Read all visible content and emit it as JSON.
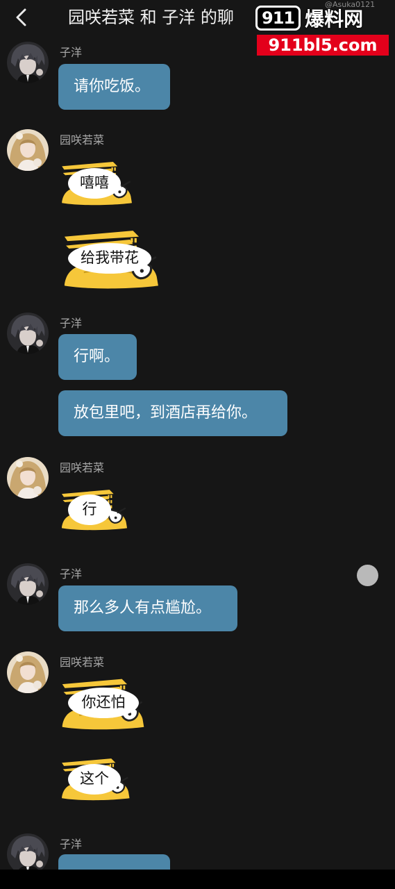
{
  "header": {
    "title": "园咲若菜 和 子洋 的聊",
    "credit": "@Asuka0121"
  },
  "watermark": {
    "logo_text": "911",
    "site_name": "爆料网",
    "url": "911bl5.com"
  },
  "participants": {
    "ziyang": "子洋",
    "wakana": "园咲若菜"
  },
  "messages": [
    {
      "sender": "子洋",
      "type": "text",
      "text": "请你吃饭。"
    },
    {
      "sender": "园咲若菜",
      "type": "sticker",
      "text": "嘻嘻"
    },
    {
      "sender": "园咲若菜",
      "type": "sticker",
      "text": "给我带花"
    },
    {
      "sender": "子洋",
      "type": "text",
      "text": "行啊。"
    },
    {
      "sender": "子洋",
      "type": "text",
      "text": "放包里吧，到酒店再给你。"
    },
    {
      "sender": "园咲若菜",
      "type": "sticker",
      "text": "行"
    },
    {
      "sender": "子洋",
      "type": "text",
      "text": "那么多人有点尴尬。"
    },
    {
      "sender": "园咲若菜",
      "type": "sticker",
      "text": "你还怕"
    },
    {
      "sender": "园咲若菜",
      "type": "sticker",
      "text": "这个"
    },
    {
      "sender": "子洋",
      "type": "text",
      "text": ""
    }
  ],
  "colors": {
    "background": "#161616",
    "bubble": "#4c86a8",
    "sticker_yellow": "#f6c73a",
    "watermark_red": "#e3001b"
  }
}
